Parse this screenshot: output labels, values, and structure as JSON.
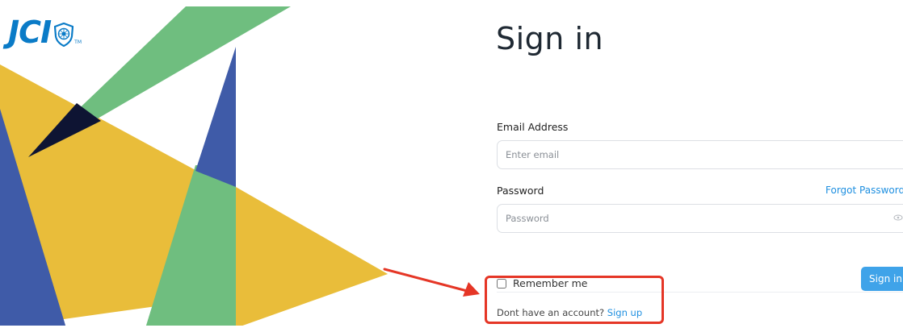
{
  "brand": {
    "logo_text": "JCI",
    "trademark": "TM",
    "colors": {
      "logo_blue": "#0a7bc7",
      "art_yellow": "#e9bd3a",
      "art_blue": "#3f5ba8",
      "art_green": "#6fbe7f",
      "art_navy": "#0e1433",
      "link_blue": "#1e8fe0",
      "button_blue": "#3fa3e9",
      "annotation_red": "#e53626"
    }
  },
  "form": {
    "title": "Sign in",
    "email": {
      "label": "Email Address",
      "placeholder": "Enter email"
    },
    "password": {
      "label": "Password",
      "placeholder": "Password",
      "forgot_link": "Forgot Password",
      "toggle_icon": "eye-icon"
    },
    "remember_label": "Remember me",
    "submit_label": "Sign in",
    "signup_prompt": "Dont have an account?",
    "signup_link": "Sign up"
  }
}
